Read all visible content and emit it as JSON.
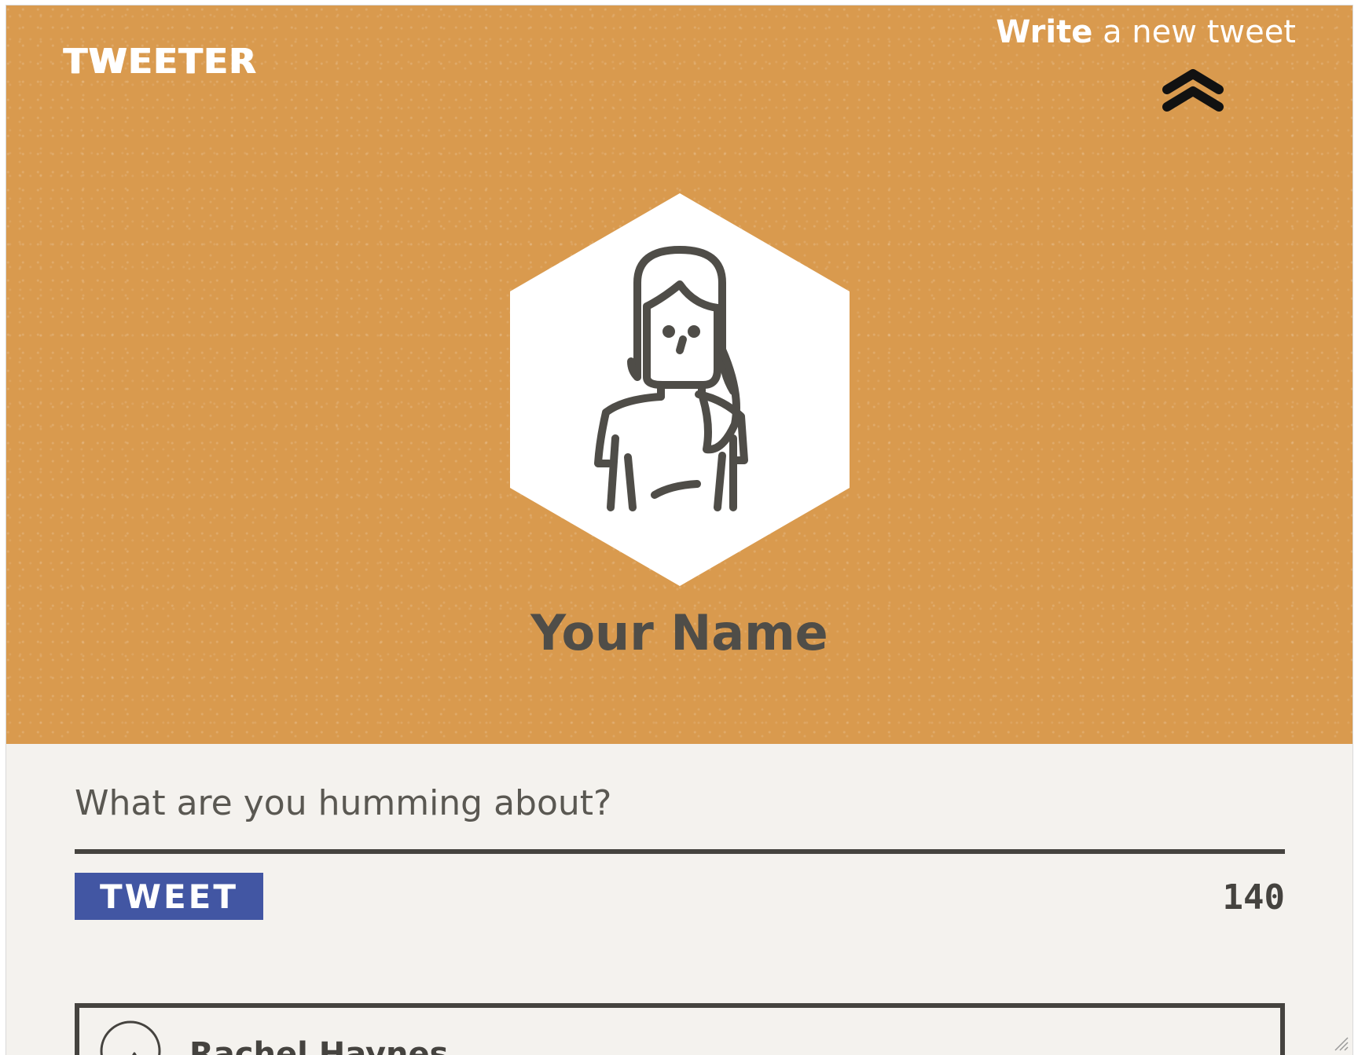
{
  "header": {
    "brand": "TWEETER",
    "compose_toggle": {
      "strong": "Write",
      "rest": " a new tweet",
      "icon": "chevron-double-up-icon"
    },
    "profile": {
      "avatar_icon": "woman-avatar-icon",
      "name": "Your Name"
    }
  },
  "compose": {
    "placeholder": "What are you humming about?",
    "value": "",
    "button_label": "TWEET",
    "char_count": "140"
  },
  "feed": {
    "tweets": [
      {
        "avatar_icon": "man-avatar-icon",
        "author": "Rachel Haynes"
      }
    ]
  },
  "colors": {
    "header_bg": "#d99a4e",
    "page_bg": "#f4f2ee",
    "text_dark": "#4f4d48",
    "button_bg": "#4256a3"
  }
}
